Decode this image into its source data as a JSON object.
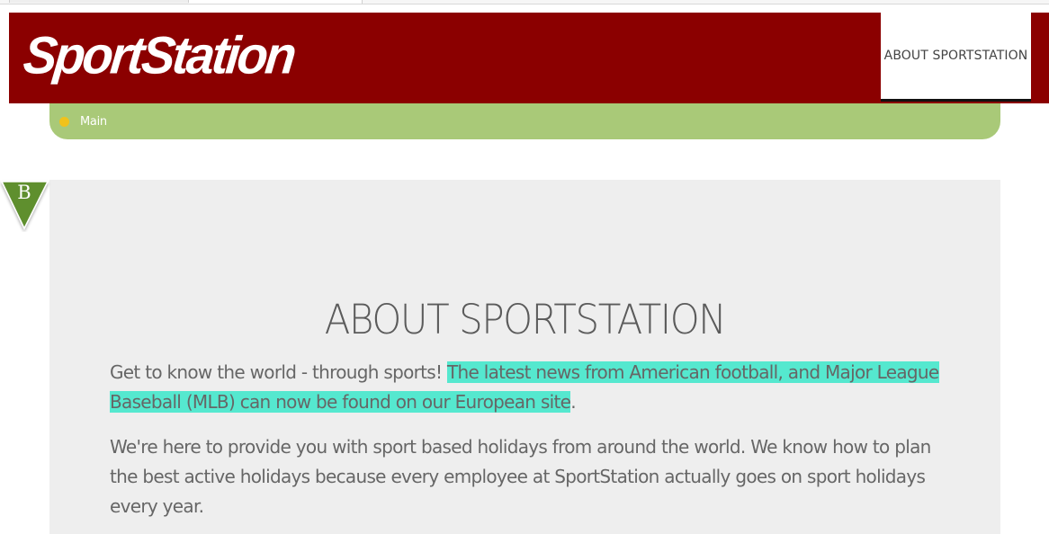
{
  "brand": {
    "logo_text": "SportStation",
    "header_color": "#8b0000",
    "accent_green": "#a9c978",
    "highlight_color": "#55e8cf"
  },
  "nav": {
    "about_label": "ABOUT SPORTSTATION"
  },
  "breadcrumb": {
    "items": [
      {
        "label": "Main",
        "icon": "dot-icon"
      }
    ]
  },
  "marker": {
    "letter": "B",
    "color": "#5e8f2e"
  },
  "main": {
    "title": "ABOUT SPORTSTATION",
    "paragraph_1": {
      "plain": "Get to know the world - through sports! ",
      "highlighted": "The latest news from American football, and Major League Baseball (MLB) can now be found on our European site",
      "end": "."
    },
    "paragraph_2": "We're here to provide you with sport based holidays from around the world. We know how to plan the best active holidays because every employee at SportStation actually goes on sport holidays every year."
  }
}
